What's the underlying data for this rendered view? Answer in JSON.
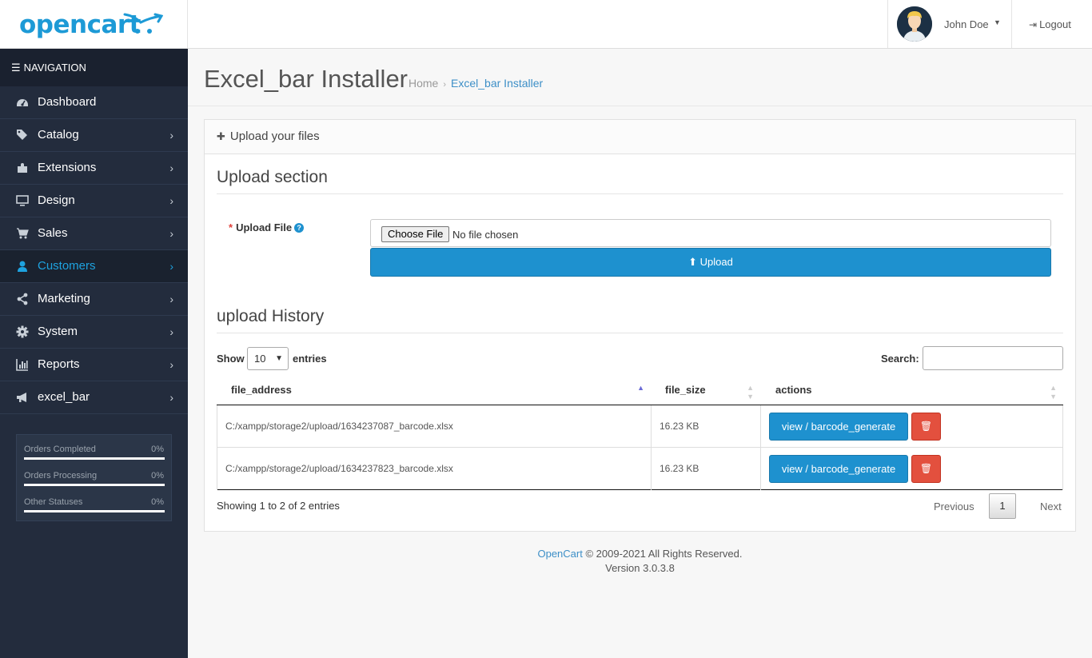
{
  "header": {
    "logo_text": "opencart",
    "user_name": "John Doe",
    "logout_label": "Logout"
  },
  "sidebar": {
    "heading": "NAVIGATION",
    "items": [
      {
        "label": "Dashboard",
        "icon": "dashboard-icon"
      },
      {
        "label": "Catalog",
        "icon": "tags-icon"
      },
      {
        "label": "Extensions",
        "icon": "puzzle-icon"
      },
      {
        "label": "Design",
        "icon": "monitor-icon"
      },
      {
        "label": "Sales",
        "icon": "cart-icon"
      },
      {
        "label": "Customers",
        "icon": "user-icon"
      },
      {
        "label": "Marketing",
        "icon": "share-icon"
      },
      {
        "label": "System",
        "icon": "gear-icon"
      },
      {
        "label": "Reports",
        "icon": "bar-chart-icon"
      },
      {
        "label": "excel_bar",
        "icon": "bullhorn-icon"
      }
    ],
    "active_item": "Customers",
    "stats": [
      {
        "label": "Orders Completed",
        "value": "0%"
      },
      {
        "label": "Orders Processing",
        "value": "0%"
      },
      {
        "label": "Other Statuses",
        "value": "0%"
      }
    ]
  },
  "page": {
    "title": "Excel_bar Installer",
    "breadcrumb": [
      "Home",
      "Excel_bar Installer"
    ]
  },
  "panel": {
    "heading": "Upload your files",
    "upload_section_title": "Upload section",
    "upload_label": "Upload File",
    "choose_file_label": "Choose File",
    "no_file_text": "No file chosen",
    "upload_button": "Upload",
    "history_title": "upload History"
  },
  "table": {
    "show_label": "Show",
    "page_length": "10",
    "entries_label": "entries",
    "search_label": "Search:",
    "search_value": "",
    "columns": [
      "file_address",
      "file_size",
      "actions"
    ],
    "rows": [
      {
        "file_address": "C:/xampp/storage2/upload/1634237087_barcode.xlsx",
        "file_size": "16.23 KB",
        "action_label": "view / barcode_generate"
      },
      {
        "file_address": "C:/xampp/storage2/upload/1634237823_barcode.xlsx",
        "file_size": "16.23 KB",
        "action_label": "view / barcode_generate"
      }
    ],
    "info": "Showing 1 to 2 of 2 entries",
    "prev_label": "Previous",
    "current_page": "1",
    "next_label": "Next"
  },
  "footer": {
    "brand": "OpenCart",
    "copyright": " © 2009-2021 All Rights Reserved.",
    "version": "Version 3.0.3.8"
  },
  "colors": {
    "primary": "#1e91cf",
    "danger": "#e3503e",
    "sidebar_bg": "#232c3d",
    "active": "#1ea3e0"
  }
}
